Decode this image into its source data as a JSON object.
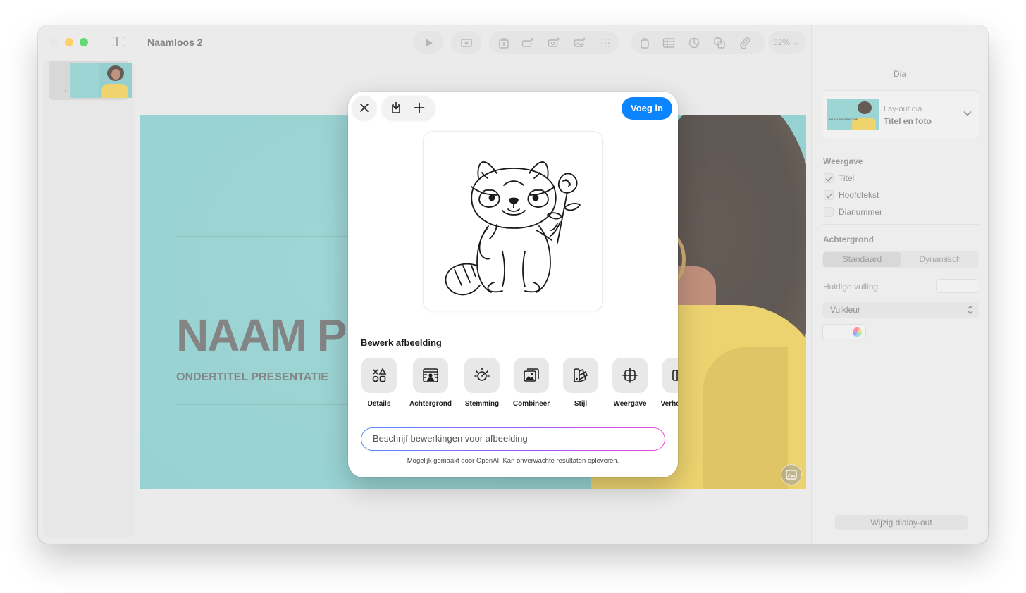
{
  "window": {
    "title": "Naamloos 2",
    "zoom": "52%"
  },
  "navigator": {
    "slides": [
      {
        "number": "1"
      }
    ]
  },
  "slide": {
    "title": "NAAM P",
    "subtitle": "ONDERTITEL PRESENTATIE"
  },
  "inspector": {
    "tab": "Dia",
    "layout_label": "Lay-out dia",
    "layout_value": "Titel en foto",
    "layout_thumb_text": "NAAM PRESENTATIE",
    "appearance_heading": "Weergave",
    "appearance_options": [
      {
        "label": "Titel",
        "checked": true
      },
      {
        "label": "Hoofdtekst",
        "checked": true
      },
      {
        "label": "Dianummer",
        "checked": false
      }
    ],
    "background_heading": "Achtergrond",
    "background_segments": [
      "Standaard",
      "Dynamisch"
    ],
    "current_fill_label": "Huidige vulling",
    "fill_type": "Vulkleur",
    "change_layout_button": "Wijzig dialay-out"
  },
  "dialog": {
    "insert_button": "Voeg in",
    "edit_heading": "Bewerk afbeelding",
    "tools": [
      {
        "label": "Details",
        "icon": "shapes-icon"
      },
      {
        "label": "Achtergrond",
        "icon": "background-icon"
      },
      {
        "label": "Stemming",
        "icon": "mood-icon"
      },
      {
        "label": "Combineer",
        "icon": "combine-icon"
      },
      {
        "label": "Stijl",
        "icon": "style-icon"
      },
      {
        "label": "Weergave",
        "icon": "crop-icon"
      },
      {
        "label": "Verhouding",
        "icon": "ratio-icon"
      }
    ],
    "prompt_placeholder": "Beschrijf bewerkingen voor afbeelding",
    "footer_note": "Mogelijk gemaakt door OpenAI. Kan onverwachte resultaten opleveren."
  },
  "colors": {
    "accent": "#0a84ff",
    "slide_background": "#70c1c1",
    "shirt": "#e7c23a"
  }
}
